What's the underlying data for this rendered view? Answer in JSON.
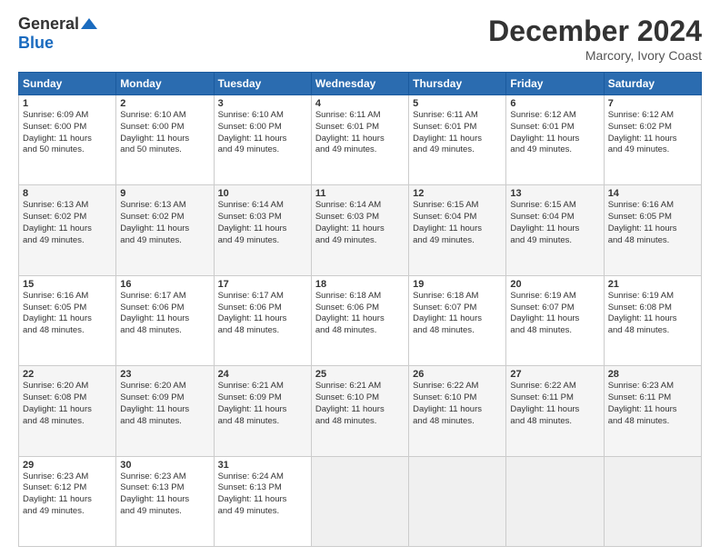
{
  "header": {
    "logo_line1": "General",
    "logo_line2": "Blue",
    "month": "December 2024",
    "location": "Marcory, Ivory Coast"
  },
  "days_of_week": [
    "Sunday",
    "Monday",
    "Tuesday",
    "Wednesday",
    "Thursday",
    "Friday",
    "Saturday"
  ],
  "weeks": [
    [
      {
        "day": "1",
        "lines": [
          "Sunrise: 6:09 AM",
          "Sunset: 6:00 PM",
          "Daylight: 11 hours",
          "and 50 minutes."
        ]
      },
      {
        "day": "2",
        "lines": [
          "Sunrise: 6:10 AM",
          "Sunset: 6:00 PM",
          "Daylight: 11 hours",
          "and 50 minutes."
        ]
      },
      {
        "day": "3",
        "lines": [
          "Sunrise: 6:10 AM",
          "Sunset: 6:00 PM",
          "Daylight: 11 hours",
          "and 49 minutes."
        ]
      },
      {
        "day": "4",
        "lines": [
          "Sunrise: 6:11 AM",
          "Sunset: 6:01 PM",
          "Daylight: 11 hours",
          "and 49 minutes."
        ]
      },
      {
        "day": "5",
        "lines": [
          "Sunrise: 6:11 AM",
          "Sunset: 6:01 PM",
          "Daylight: 11 hours",
          "and 49 minutes."
        ]
      },
      {
        "day": "6",
        "lines": [
          "Sunrise: 6:12 AM",
          "Sunset: 6:01 PM",
          "Daylight: 11 hours",
          "and 49 minutes."
        ]
      },
      {
        "day": "7",
        "lines": [
          "Sunrise: 6:12 AM",
          "Sunset: 6:02 PM",
          "Daylight: 11 hours",
          "and 49 minutes."
        ]
      }
    ],
    [
      {
        "day": "8",
        "lines": [
          "Sunrise: 6:13 AM",
          "Sunset: 6:02 PM",
          "Daylight: 11 hours",
          "and 49 minutes."
        ]
      },
      {
        "day": "9",
        "lines": [
          "Sunrise: 6:13 AM",
          "Sunset: 6:02 PM",
          "Daylight: 11 hours",
          "and 49 minutes."
        ]
      },
      {
        "day": "10",
        "lines": [
          "Sunrise: 6:14 AM",
          "Sunset: 6:03 PM",
          "Daylight: 11 hours",
          "and 49 minutes."
        ]
      },
      {
        "day": "11",
        "lines": [
          "Sunrise: 6:14 AM",
          "Sunset: 6:03 PM",
          "Daylight: 11 hours",
          "and 49 minutes."
        ]
      },
      {
        "day": "12",
        "lines": [
          "Sunrise: 6:15 AM",
          "Sunset: 6:04 PM",
          "Daylight: 11 hours",
          "and 49 minutes."
        ]
      },
      {
        "day": "13",
        "lines": [
          "Sunrise: 6:15 AM",
          "Sunset: 6:04 PM",
          "Daylight: 11 hours",
          "and 49 minutes."
        ]
      },
      {
        "day": "14",
        "lines": [
          "Sunrise: 6:16 AM",
          "Sunset: 6:05 PM",
          "Daylight: 11 hours",
          "and 48 minutes."
        ]
      }
    ],
    [
      {
        "day": "15",
        "lines": [
          "Sunrise: 6:16 AM",
          "Sunset: 6:05 PM",
          "Daylight: 11 hours",
          "and 48 minutes."
        ]
      },
      {
        "day": "16",
        "lines": [
          "Sunrise: 6:17 AM",
          "Sunset: 6:06 PM",
          "Daylight: 11 hours",
          "and 48 minutes."
        ]
      },
      {
        "day": "17",
        "lines": [
          "Sunrise: 6:17 AM",
          "Sunset: 6:06 PM",
          "Daylight: 11 hours",
          "and 48 minutes."
        ]
      },
      {
        "day": "18",
        "lines": [
          "Sunrise: 6:18 AM",
          "Sunset: 6:06 PM",
          "Daylight: 11 hours",
          "and 48 minutes."
        ]
      },
      {
        "day": "19",
        "lines": [
          "Sunrise: 6:18 AM",
          "Sunset: 6:07 PM",
          "Daylight: 11 hours",
          "and 48 minutes."
        ]
      },
      {
        "day": "20",
        "lines": [
          "Sunrise: 6:19 AM",
          "Sunset: 6:07 PM",
          "Daylight: 11 hours",
          "and 48 minutes."
        ]
      },
      {
        "day": "21",
        "lines": [
          "Sunrise: 6:19 AM",
          "Sunset: 6:08 PM",
          "Daylight: 11 hours",
          "and 48 minutes."
        ]
      }
    ],
    [
      {
        "day": "22",
        "lines": [
          "Sunrise: 6:20 AM",
          "Sunset: 6:08 PM",
          "Daylight: 11 hours",
          "and 48 minutes."
        ]
      },
      {
        "day": "23",
        "lines": [
          "Sunrise: 6:20 AM",
          "Sunset: 6:09 PM",
          "Daylight: 11 hours",
          "and 48 minutes."
        ]
      },
      {
        "day": "24",
        "lines": [
          "Sunrise: 6:21 AM",
          "Sunset: 6:09 PM",
          "Daylight: 11 hours",
          "and 48 minutes."
        ]
      },
      {
        "day": "25",
        "lines": [
          "Sunrise: 6:21 AM",
          "Sunset: 6:10 PM",
          "Daylight: 11 hours",
          "and 48 minutes."
        ]
      },
      {
        "day": "26",
        "lines": [
          "Sunrise: 6:22 AM",
          "Sunset: 6:10 PM",
          "Daylight: 11 hours",
          "and 48 minutes."
        ]
      },
      {
        "day": "27",
        "lines": [
          "Sunrise: 6:22 AM",
          "Sunset: 6:11 PM",
          "Daylight: 11 hours",
          "and 48 minutes."
        ]
      },
      {
        "day": "28",
        "lines": [
          "Sunrise: 6:23 AM",
          "Sunset: 6:11 PM",
          "Daylight: 11 hours",
          "and 48 minutes."
        ]
      }
    ],
    [
      {
        "day": "29",
        "lines": [
          "Sunrise: 6:23 AM",
          "Sunset: 6:12 PM",
          "Daylight: 11 hours",
          "and 49 minutes."
        ]
      },
      {
        "day": "30",
        "lines": [
          "Sunrise: 6:23 AM",
          "Sunset: 6:13 PM",
          "Daylight: 11 hours",
          "and 49 minutes."
        ]
      },
      {
        "day": "31",
        "lines": [
          "Sunrise: 6:24 AM",
          "Sunset: 6:13 PM",
          "Daylight: 11 hours",
          "and 49 minutes."
        ]
      },
      {
        "day": "",
        "lines": []
      },
      {
        "day": "",
        "lines": []
      },
      {
        "day": "",
        "lines": []
      },
      {
        "day": "",
        "lines": []
      }
    ]
  ]
}
